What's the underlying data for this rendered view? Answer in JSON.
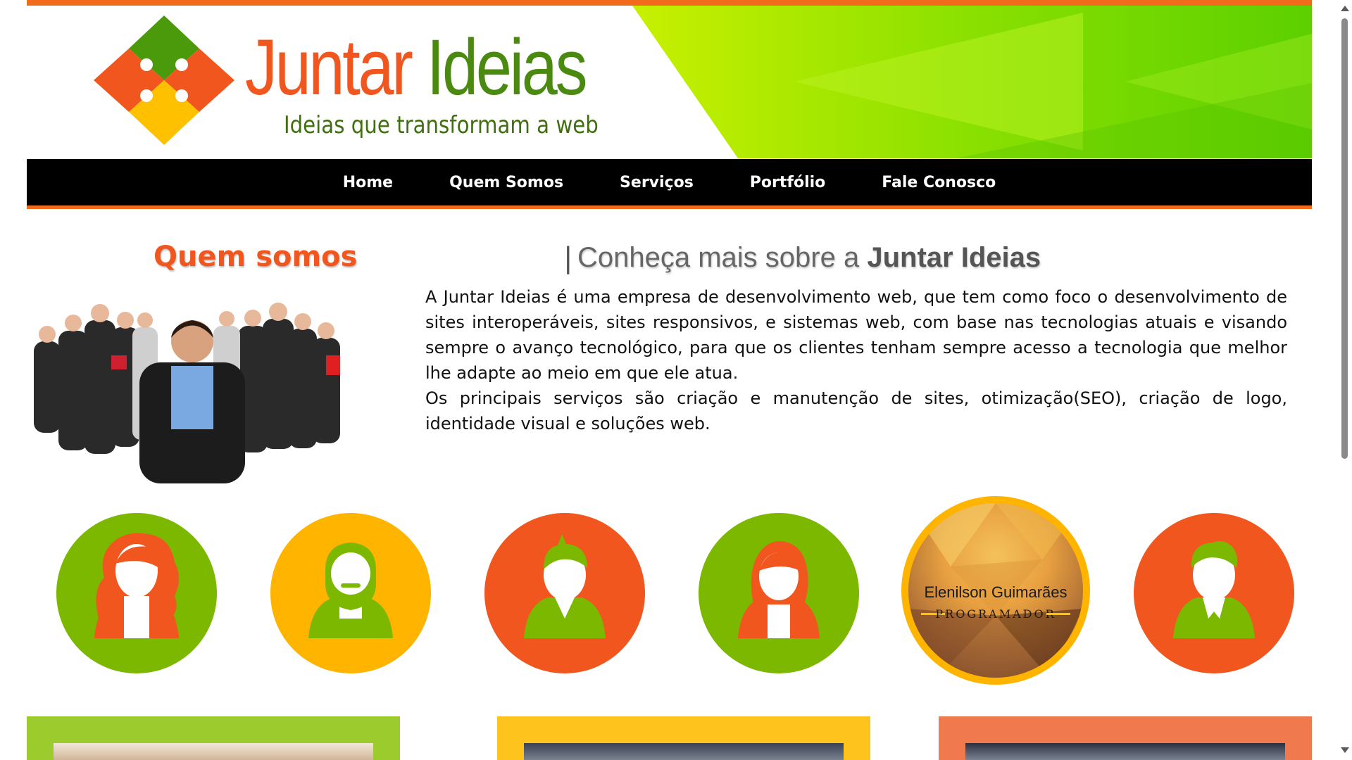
{
  "header": {
    "logo_word1": "Juntar",
    "logo_word2": "Ideias",
    "tagline": "Ideias que transformam a web",
    "brand_colors": {
      "orange": "#f26b1d",
      "red_orange": "#f1561f",
      "green": "#7cb800",
      "yellow": "#ffb400",
      "dark_green": "#4a8a10"
    }
  },
  "nav": {
    "items": [
      {
        "label": "Home"
      },
      {
        "label": "Quem Somos"
      },
      {
        "label": "Serviços"
      },
      {
        "label": "Portfólio"
      },
      {
        "label": "Fale Conosco"
      }
    ]
  },
  "about": {
    "title": "Quem somos",
    "divider": "|",
    "subtitle_prefix": "Conheça mais sobre a",
    "subtitle_brand": "Juntar Ideias",
    "paragraph1": "A Juntar Ideias é uma empresa de desenvolvimento web, que tem como foco o desenvolvimento de sites interoperáveis, sites responsivos, e sistemas web, com base nas tecnologias atuais e visando sempre o avanço tecnológico, para que os clientes tenham sempre acesso a tecnologia que melhor lhe adapte ao meio em que ele atua.",
    "paragraph2": "Os principais serviços são criação e manutenção de sites, otimização(SEO), criação de logo, identidade visual e soluções web."
  },
  "team": {
    "featured": {
      "name": "Elenilson Guimarães",
      "role": "PROGRAMADOR"
    },
    "avatars": [
      {
        "icon": "female-avatar-icon",
        "bg": "#7cb800",
        "fg": "#f1561f"
      },
      {
        "icon": "bearded-male-avatar-icon",
        "bg": "#ffb400",
        "fg": "#7cb800"
      },
      {
        "icon": "male-avatar-icon",
        "bg": "#f1561f",
        "fg": "#7cb800"
      },
      {
        "icon": "female-avatar-icon",
        "bg": "#7cb800",
        "fg": "#f1561f"
      },
      {
        "icon": "male-avatar-icon",
        "bg": "#f1561f",
        "fg": "#7cb800"
      }
    ]
  },
  "cards": [
    {
      "color": "#9ccb2e"
    },
    {
      "color": "#ffc31e"
    },
    {
      "color": "#f07a4e"
    }
  ]
}
